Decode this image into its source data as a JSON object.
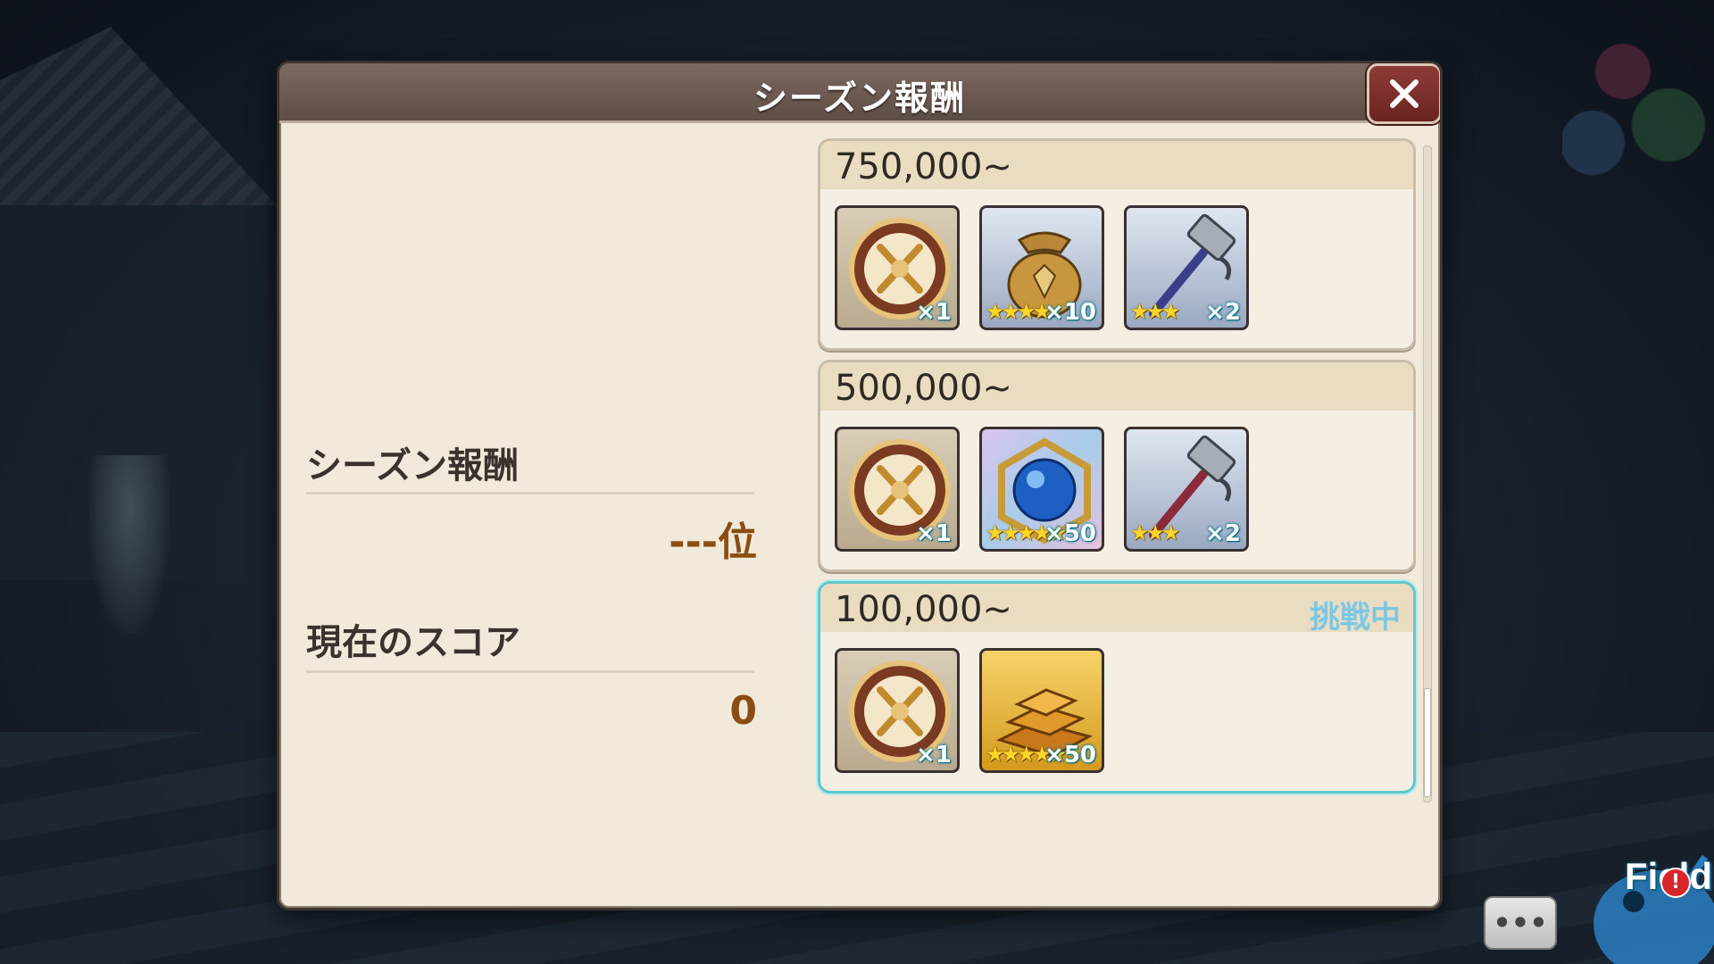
{
  "dialog": {
    "title": "シーズン報酬",
    "close_icon": "close-icon"
  },
  "summary": {
    "season_reward_label": "シーズン報酬",
    "rank_value": "---位",
    "current_score_label": "現在のスコア",
    "current_score_value": "0"
  },
  "tiers": [
    {
      "score": "750,000~",
      "status": "",
      "items": [
        {
          "icon": "crest-emblem-icon",
          "stars": "",
          "qty": "×1"
        },
        {
          "icon": "gold-bag-icon",
          "stars": "★★★★",
          "qty": "×10"
        },
        {
          "icon": "blue-hammer-icon",
          "stars": "★★★",
          "qty": "×2"
        }
      ]
    },
    {
      "score": "500,000~",
      "status": "",
      "items": [
        {
          "icon": "crest-emblem-icon",
          "stars": "",
          "qty": "×1"
        },
        {
          "icon": "blue-orb-icon",
          "stars": "★★★★★",
          "qty": "×50"
        },
        {
          "icon": "red-hammer-icon",
          "stars": "★★★",
          "qty": "×2"
        }
      ]
    },
    {
      "score": "100,000~",
      "status": "挑戦中",
      "items": [
        {
          "icon": "crest-emblem-icon",
          "stars": "",
          "qty": "×1"
        },
        {
          "icon": "gold-bars-icon",
          "stars": "★★★★★",
          "qty": "×50"
        }
      ]
    }
  ],
  "hud": {
    "chat_label": "•••",
    "field_label": "Field",
    "alert": "!"
  },
  "colors": {
    "active_border": "#5fc8cc",
    "status_text": "#7cc7e4",
    "score_value": "#8b4d12"
  }
}
